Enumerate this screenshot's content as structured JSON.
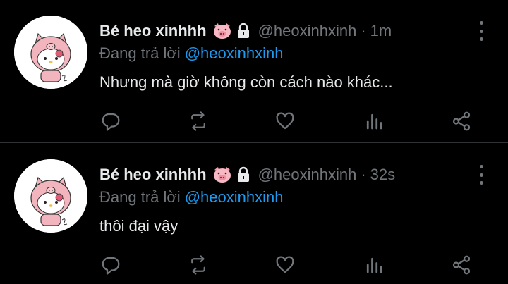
{
  "theme": {
    "background": "#000000",
    "text": "#e7e9ea",
    "muted": "#71767b",
    "accent": "#1d9bf0",
    "divider": "#2f3336"
  },
  "tweets": [
    {
      "display_name": "Bé heo xinhhh",
      "name_emoji": "pig-face",
      "protected_icon": "lock-icon",
      "handle": "@heoxinhxinh",
      "separator": "·",
      "time": "1m",
      "replying_label": "Đang trả lời",
      "replying_to": "@heoxinhxinh",
      "text": "Nhưng mà giờ không còn cách nào khác...",
      "actions": [
        "reply-icon",
        "retweet-icon",
        "like-icon",
        "views-icon",
        "share-icon"
      ]
    },
    {
      "display_name": "Bé heo xinhhh",
      "name_emoji": "pig-face",
      "protected_icon": "lock-icon",
      "handle": "@heoxinhxinh",
      "separator": "·",
      "time": "32s",
      "replying_label": "Đang trả lời",
      "replying_to": "@heoxinhxinh",
      "text": "thôi đại vậy",
      "actions": [
        "reply-icon",
        "retweet-icon",
        "like-icon",
        "views-icon",
        "share-icon"
      ]
    }
  ]
}
